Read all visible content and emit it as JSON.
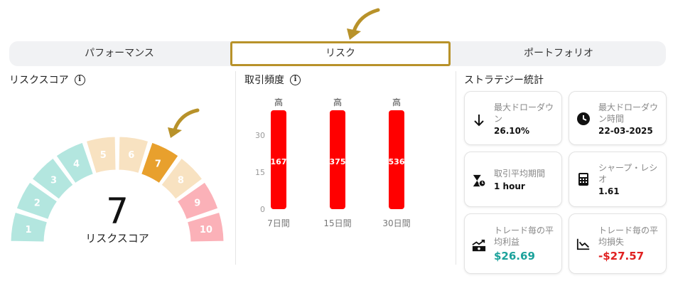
{
  "tabs": {
    "performance": "パフォーマンス",
    "risk": "リスク",
    "portfolio": "ポートフォリオ"
  },
  "risk_score": {
    "title": "リスクスコア",
    "segments": [
      "1",
      "2",
      "3",
      "4",
      "5",
      "6",
      "7",
      "8",
      "9",
      "10"
    ],
    "value": "7",
    "caption": "リスクスコア",
    "colors": {
      "low": "#b3e6df",
      "mid": "#f8e2c1",
      "selected": "#e8a02d",
      "high": "#fbb1b8"
    }
  },
  "trade_frequency": {
    "title": "取引頻度",
    "chart_data": {
      "type": "bar",
      "categories": [
        "7日間",
        "15日間",
        "30日間"
      ],
      "values": [
        167,
        375,
        536
      ],
      "level_labels": [
        "高",
        "高",
        "高"
      ],
      "yticks": [
        "0",
        "15",
        "30"
      ],
      "bar_color": "#ff0000"
    }
  },
  "strategy_stats": {
    "title": "ストラテジー統計",
    "cards": [
      {
        "label": "最大ドローダウン",
        "value": "26.10%",
        "icon": "arrow-down-icon"
      },
      {
        "label": "最大ドローダウン時間",
        "value": "22-03-2025",
        "icon": "clock-icon"
      },
      {
        "label": "取引平均期間",
        "value": "1 hour",
        "icon": "hourglass-icon"
      },
      {
        "label": "シャープ・レシオ",
        "value": "1.61",
        "icon": "calculator-icon"
      },
      {
        "label": "トレード毎の平均利益",
        "value": "$26.69",
        "icon": "money-up-icon"
      },
      {
        "label": "トレード毎の平均損失",
        "value": "-$27.57",
        "icon": "chart-down-icon"
      }
    ]
  },
  "annotation_color": "#b8922a"
}
